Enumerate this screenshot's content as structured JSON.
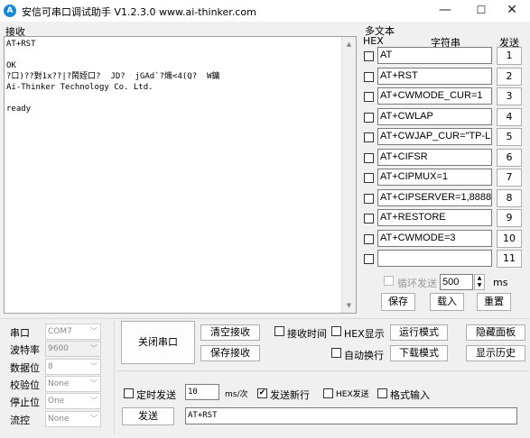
{
  "window": {
    "title": "安信可串口调试助手 V1.2.3.0    www.ai-thinker.com",
    "icon_name": "app-logo-icon",
    "minimize": "—",
    "maximize": "☐",
    "close": "✕"
  },
  "receive": {
    "label": "接收",
    "text": "AT+RST\n\nOK\n?口)??對1x??|?鬧姪口?  JD?  jGAd`?熾<4(Q?  W鏞\nAi-Thinker Technology Co. Ltd.\n\nready"
  },
  "multi": {
    "label": "多文本",
    "hex_header": "HEX",
    "string_header": "字符串",
    "send_header": "发送",
    "rows": [
      {
        "value": "AT",
        "button": "1"
      },
      {
        "value": "AT+RST",
        "button": "2"
      },
      {
        "value": "AT+CWMODE_CUR=1",
        "button": "3"
      },
      {
        "value": "AT+CWLAP",
        "button": "4"
      },
      {
        "value": "AT+CWJAP_CUR=\"TP-LIN",
        "button": "5"
      },
      {
        "value": "AT+CIFSR",
        "button": "6"
      },
      {
        "value": "AT+CIPMUX=1",
        "button": "7"
      },
      {
        "value": "AT+CIPSERVER=1,8888",
        "button": "8"
      },
      {
        "value": "AT+RESTORE",
        "button": "9"
      },
      {
        "value": "AT+CWMODE=3",
        "button": "10"
      },
      {
        "value": "",
        "button": "11"
      }
    ],
    "loop_label": "循环发送",
    "loop_value": "500",
    "loop_unit": "ms",
    "save": "保存",
    "load": "载入",
    "reset": "重置"
  },
  "port": {
    "labels": [
      "串口",
      "波特率",
      "数据位",
      "校验位",
      "停止位",
      "流控"
    ],
    "values": [
      "COM7",
      "9600",
      "8",
      "None",
      "One",
      "None"
    ],
    "close_button": "关闭串口"
  },
  "controls": {
    "clear_receive": "清空接收",
    "save_receive": "保存接收",
    "receive_time": "接收时间",
    "hex_display": "HEX显示",
    "run_mode": "运行模式",
    "hide_panel": "隐藏面板",
    "auto_wrap": "自动换行",
    "download_mode": "下载模式",
    "show_history": "显示历史"
  },
  "send": {
    "timed_send": "定时发送",
    "interval": "10",
    "interval_unit": "ms/次",
    "send_newline": "发送新行",
    "hex_send": "HEX发送",
    "format_input": "格式输入",
    "send_button": "发送",
    "send_text": "AT+RST"
  }
}
